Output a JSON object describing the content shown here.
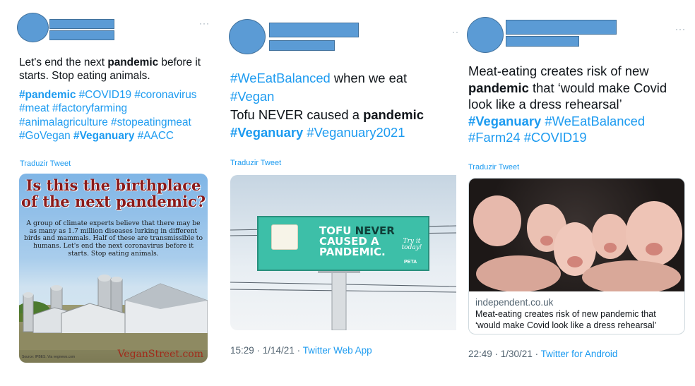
{
  "tweets": [
    {
      "more": "···",
      "text_lines": [
        [
          {
            "t": "Let's end the next "
          },
          {
            "t": "pandemic",
            "b": true
          },
          {
            "t": " before it"
          }
        ],
        [
          {
            "t": "starts. Stop eating animals."
          }
        ]
      ],
      "tag_lines": [
        [
          {
            "t": "#pandemic",
            "bt": true
          },
          {
            "t": " #COVID19 #coronavirus"
          }
        ],
        [
          {
            "t": "#meat #factoryfarming"
          }
        ],
        [
          {
            "t": "#animalagriculture #stopeatingmeat"
          }
        ],
        [
          {
            "t": "#GoVegan "
          },
          {
            "t": "#Veganuary",
            "bt": true
          },
          {
            "t": " #AACC"
          }
        ]
      ],
      "translate": "Traduzir Tweet",
      "image": {
        "headline": "Is this the birthplace of the next pandemic?",
        "body": "A group of climate experts believe that there may be as many as 1.7 million diseases lurking in different birds and mammals. Half of these are transmissible to humans. Let's end the next coronavirus before it starts. Stop eating animals.",
        "brand": "VeganStreet.com",
        "credit": "Source: IPBES. Via vegnews.com"
      }
    },
    {
      "more": "··",
      "lines": [
        [
          {
            "t": "#WeEatBalanced",
            "tag": true
          },
          {
            "t": " when we eat"
          }
        ],
        [
          {
            "t": "#Vegan",
            "tag": true
          }
        ],
        [
          {
            "t": "Tofu NEVER caused a "
          },
          {
            "t": "pandemic",
            "b": true
          }
        ],
        [
          {
            "t": "#Veganuary",
            "tag": true,
            "bt": true
          },
          {
            "t": " #Veganuary2021",
            "tag": true
          }
        ]
      ],
      "translate": "Traduzir Tweet",
      "billboard": {
        "line1a": "TOFU",
        "line1b": " NEVER",
        "line2": "CAUSED A",
        "line3": "PANDEMIC.",
        "try_it": "Try it today!",
        "peta": "PETA"
      },
      "footer": {
        "time": "15:29 · 1/14/21 · ",
        "source": "Twitter Web App"
      }
    },
    {
      "more": "···",
      "lines": [
        [
          {
            "t": "Meat-eating creates risk of new"
          }
        ],
        [
          {
            "t": "pandemic",
            "b": true
          },
          {
            "t": " that ‘would make Covid"
          }
        ],
        [
          {
            "t": "look like a dress rehearsal’"
          }
        ],
        [
          {
            "t": "#Veganuary",
            "tag": true,
            "bt": true
          },
          {
            "t": " #WeEatBalanced",
            "tag": true
          }
        ],
        [
          {
            "t": "#Farm24 #COVID19",
            "tag": true
          }
        ]
      ],
      "translate": "Traduzir Tweet",
      "card": {
        "domain": "independent.co.uk",
        "title": "Meat-eating creates risk of new pandemic that ‘would make Covid look like a dress rehearsal’"
      },
      "footer": {
        "time": "22:49 · 1/30/21 · ",
        "source": "Twitter for Android"
      }
    }
  ],
  "colors": {
    "link": "#1d9bf0",
    "redaction": "#5b9bd5",
    "text": "#0f1419",
    "muted": "#536471"
  }
}
